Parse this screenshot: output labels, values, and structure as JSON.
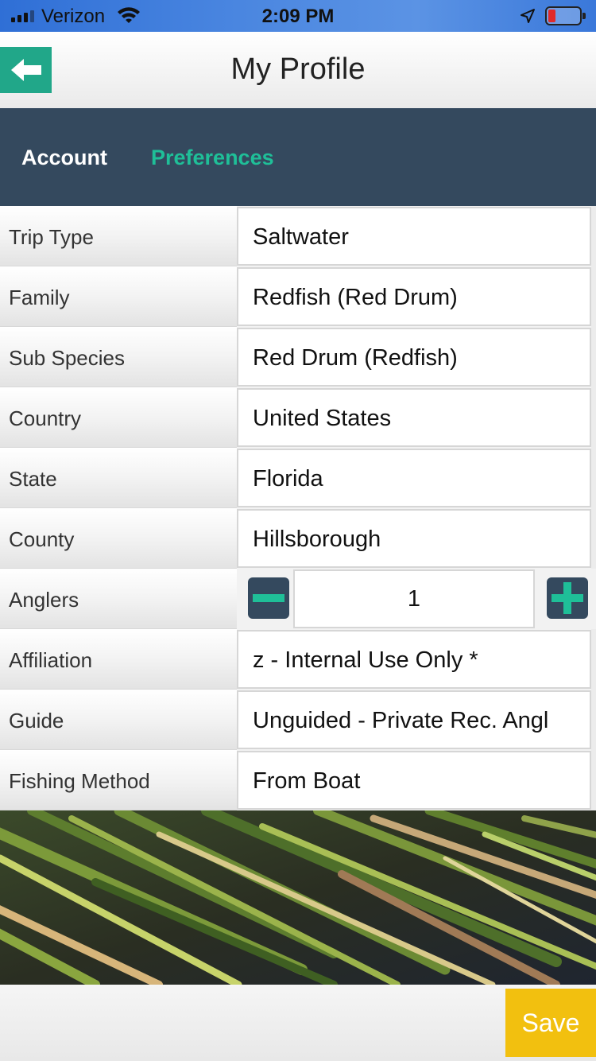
{
  "status_bar": {
    "carrier": "Verizon",
    "time": "2:09 PM",
    "battery_color": "#e02a2a"
  },
  "header": {
    "title": "My Profile",
    "back_icon": "arrow-left-icon"
  },
  "tabs": [
    {
      "label": "Account",
      "active": false
    },
    {
      "label": "Preferences",
      "active": true
    }
  ],
  "form": {
    "trip_type": {
      "label": "Trip Type",
      "value": "Saltwater"
    },
    "family": {
      "label": "Family",
      "value": "Redfish (Red Drum)"
    },
    "sub_species": {
      "label": "Sub Species",
      "value": "Red Drum (Redfish)"
    },
    "country": {
      "label": "Country",
      "value": "United States"
    },
    "state": {
      "label": "State",
      "value": "Florida"
    },
    "county": {
      "label": "County",
      "value": "Hillsborough"
    },
    "anglers": {
      "label": "Anglers",
      "value": "1"
    },
    "affiliation": {
      "label": "Affiliation",
      "value": "z - Internal Use Only *"
    },
    "guide": {
      "label": "Guide",
      "value": "Unguided - Private Rec. Angl"
    },
    "fishing_method": {
      "label": "Fishing Method",
      "value": "From Boat"
    }
  },
  "footer": {
    "save_label": "Save"
  },
  "colors": {
    "accent_teal": "#1fbf98",
    "back_button": "#21a789",
    "tab_bar": "#34495e",
    "save_button": "#f2c00f"
  }
}
